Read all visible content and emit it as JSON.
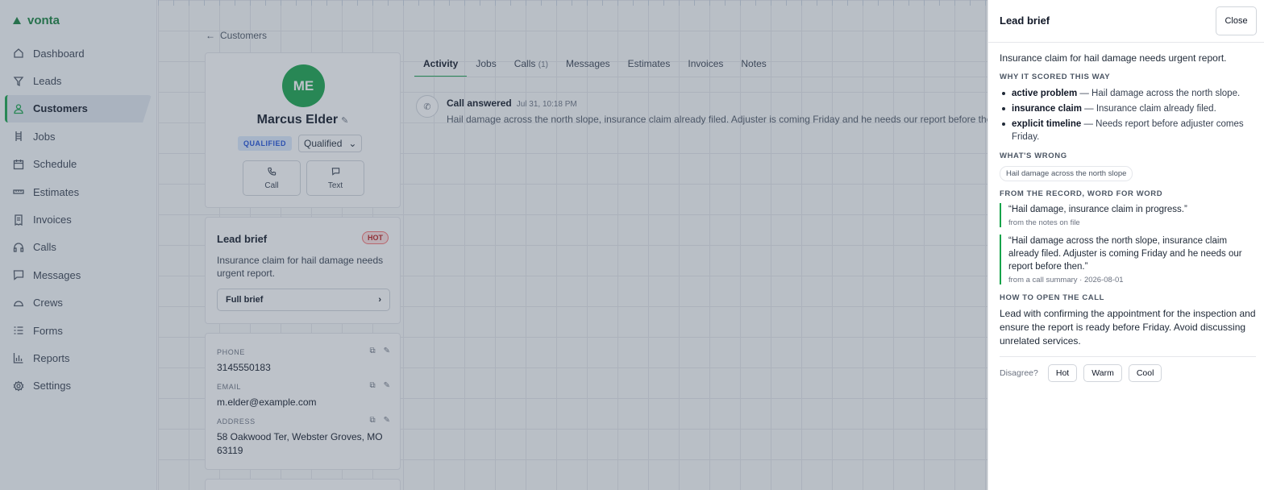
{
  "app": {
    "brand": "vonta"
  },
  "sidebar": {
    "items": [
      {
        "label": "Dashboard",
        "icon": "home-icon"
      },
      {
        "label": "Leads",
        "icon": "funnel-icon"
      },
      {
        "label": "Customers",
        "icon": "user-icon",
        "active": true
      },
      {
        "label": "Jobs",
        "icon": "ladder-icon"
      },
      {
        "label": "Schedule",
        "icon": "calendar-icon"
      },
      {
        "label": "Estimates",
        "icon": "ruler-icon"
      },
      {
        "label": "Invoices",
        "icon": "receipt-icon"
      },
      {
        "label": "Calls",
        "icon": "headset-icon"
      },
      {
        "label": "Messages",
        "icon": "chat-icon"
      },
      {
        "label": "Crews",
        "icon": "hardhat-icon"
      },
      {
        "label": "Forms",
        "icon": "list-icon"
      },
      {
        "label": "Reports",
        "icon": "bar-chart-icon"
      },
      {
        "label": "Settings",
        "icon": "gear-icon"
      }
    ]
  },
  "page": {
    "back_label": "Customers",
    "customer": {
      "initials": "ME",
      "name": "Marcus Elder",
      "status_badge": "QUALIFIED",
      "status_value": "Qualified",
      "call_label": "Call",
      "text_label": "Text"
    },
    "lead_brief_card": {
      "title": "Lead brief",
      "badge": "HOT",
      "summary": "Insurance claim for hail damage needs urgent report.",
      "full_brief_label": "Full brief"
    },
    "contact": {
      "phone_label": "PHONE",
      "phone": "3145550183",
      "email_label": "EMAIL",
      "email": "m.elder@example.com",
      "address_label": "ADDRESS",
      "address": "58 Oakwood Ter, Webster Groves, MO 63119"
    },
    "tabs": [
      {
        "label": "Activity",
        "active": true
      },
      {
        "label": "Jobs"
      },
      {
        "label": "Calls",
        "count": "(1)"
      },
      {
        "label": "Messages"
      },
      {
        "label": "Estimates"
      },
      {
        "label": "Invoices"
      },
      {
        "label": "Notes"
      }
    ],
    "activity": {
      "title": "Call answered",
      "time": "Jul 31, 10:18 PM",
      "body": "Hail damage across the north slope, insurance claim already filed. Adjuster is coming Friday and he needs our report before then."
    }
  },
  "drawer": {
    "title": "Lead brief",
    "close_label": "Close",
    "summary": "Insurance claim for hail damage needs urgent report.",
    "why_heading": "WHY IT SCORED THIS WAY",
    "reasons": [
      {
        "key": "active problem",
        "text": " — Hail damage across the north slope."
      },
      {
        "key": "insurance claim",
        "text": " — Insurance claim already filed."
      },
      {
        "key": "explicit timeline",
        "text": " — Needs report before adjuster comes Friday."
      }
    ],
    "wrong_heading": "WHAT'S WRONG",
    "wrong_chip": "Hail damage across the north slope",
    "record_heading": "FROM THE RECORD, WORD FOR WORD",
    "quotes": [
      {
        "text": "“Hail damage, insurance claim in progress.”",
        "source": "from the notes on file"
      },
      {
        "text": "“Hail damage across the north slope, insurance claim already filed. Adjuster is coming Friday and he needs our report before then.”",
        "source": "from a call summary · 2026-08-01"
      }
    ],
    "open_heading": "HOW TO OPEN THE CALL",
    "open_text": "Lead with confirming the appointment for the inspection and ensure the report is ready before Friday. Avoid discussing unrelated services.",
    "disagree_label": "Disagree?",
    "disagree_options": [
      "Hot",
      "Warm",
      "Cool"
    ]
  },
  "colors": {
    "accent": "#16a34a",
    "hot": "#b91c1c",
    "qualified": "#1d4ed8"
  }
}
